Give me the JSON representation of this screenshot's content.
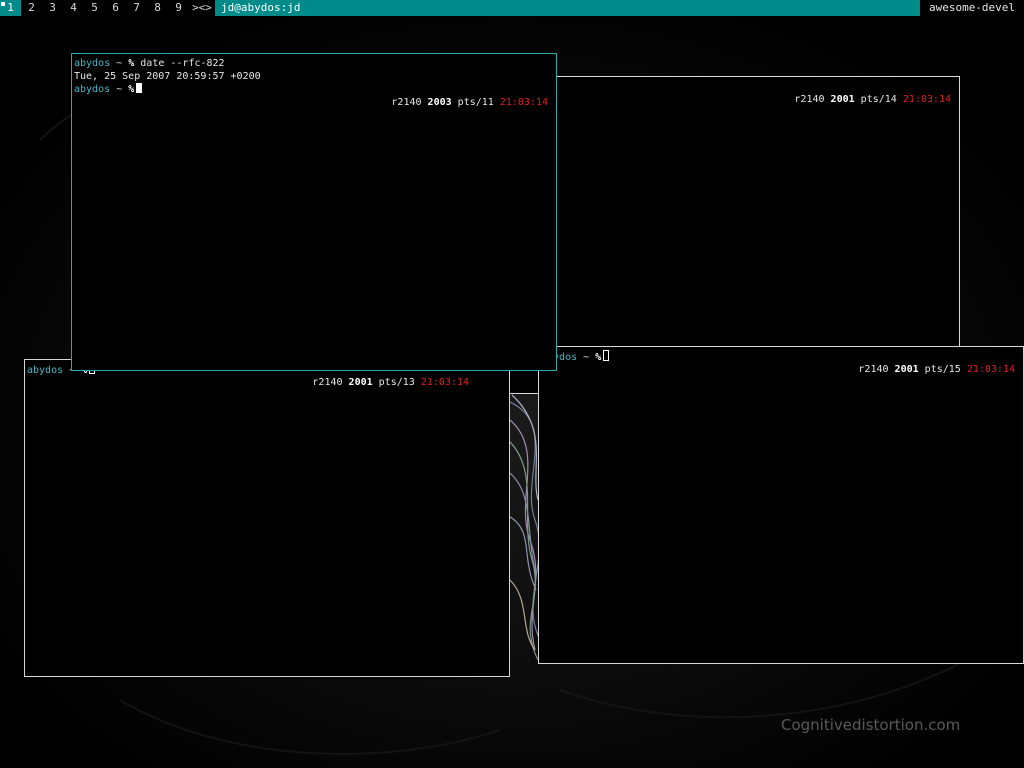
{
  "taskbar": {
    "tags": [
      "1",
      "2",
      "3",
      "4",
      "5",
      "6",
      "7",
      "8",
      "9"
    ],
    "active_tag": "1",
    "layout_symbol": "><>",
    "window_title": "jd@abydos:jd",
    "status_text": "awesome-devel"
  },
  "terminals": {
    "t11": {
      "line1": {
        "host": "abydos",
        "tilde": "~",
        "pct": "%",
        "cmd": "date --rfc-822"
      },
      "output": "Tue, 25 Sep 2007 20:59:57 +0200",
      "line3": {
        "host": "abydos",
        "tilde": "~",
        "pct": "%"
      },
      "status": {
        "rev": "r2140",
        "num": "2003",
        "pts": "pts/11",
        "time": "21:03:14"
      }
    },
    "t14": {
      "status": {
        "rev": "r2140",
        "num": "2001",
        "pts": "pts/14",
        "time": "21:03:14"
      }
    },
    "t13": {
      "line1": {
        "host": "abydos",
        "tilde": "~",
        "pct": "%"
      },
      "status": {
        "rev": "r2140",
        "num": "2001",
        "pts": "pts/13",
        "time": "21:03:14"
      }
    },
    "t15": {
      "line1": {
        "host": "abydos",
        "tilde": "~",
        "pct": "%"
      },
      "status": {
        "rev": "r2140",
        "num": "2001",
        "pts": "pts/15",
        "time": "21:03:14"
      }
    }
  },
  "watermark": "Cognitivedistortion.com",
  "colors": {
    "bar": "#008b8b",
    "host": "#47b6c6",
    "time": "#e0201f",
    "focused_border": "#2aa7a7"
  }
}
